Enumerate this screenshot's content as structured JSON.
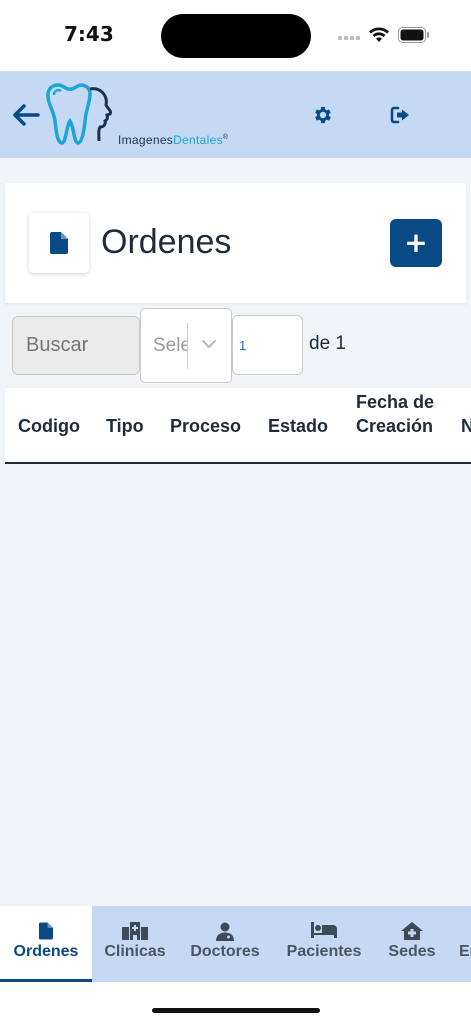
{
  "status_bar": {
    "time": "7:43"
  },
  "header": {
    "logo_text_part1": "Imagenes",
    "logo_text_part2": "Dentales",
    "logo_registered": "®"
  },
  "page": {
    "title": "Ordenes"
  },
  "filters": {
    "search_placeholder": "Buscar",
    "select_value": "Sele",
    "page_number": "1",
    "page_of": "de 1"
  },
  "table": {
    "columns": [
      "Codigo",
      "Tipo",
      "Proceso",
      "Estado",
      "Fecha de Creación",
      "N"
    ]
  },
  "tabs": [
    {
      "label": "Ordenes",
      "icon": "document-icon",
      "active": true
    },
    {
      "label": "Clinicas",
      "icon": "hospital-icon",
      "active": false
    },
    {
      "label": "Doctores",
      "icon": "doctor-icon",
      "active": false
    },
    {
      "label": "Pacientes",
      "icon": "bed-icon",
      "active": false
    },
    {
      "label": "Sedes",
      "icon": "clinic-house-icon",
      "active": false
    },
    {
      "label": "Er",
      "icon": "",
      "active": false
    }
  ],
  "colors": {
    "header_bg": "#c5d9f5",
    "primary": "#0a4a84",
    "page_bg": "#f1f4f8",
    "logo_cyan": "#1aa6d6"
  }
}
